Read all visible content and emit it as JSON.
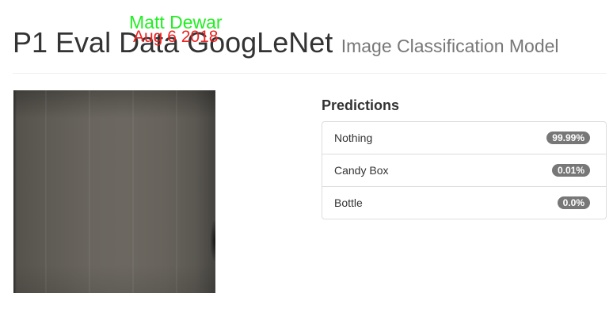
{
  "header": {
    "title": "P1 Eval Data GoogLeNet",
    "subtitle": "Image Classification Model"
  },
  "overlay": {
    "name": "Matt Dewar",
    "date": "Aug 6 2018",
    "name_color": "#22ee22",
    "date_color": "#ee2222"
  },
  "predictions": {
    "heading": "Predictions",
    "items": [
      {
        "label": "Nothing",
        "value": "99.99%"
      },
      {
        "label": "Candy Box",
        "value": "0.01%"
      },
      {
        "label": "Bottle",
        "value": "0.0%"
      }
    ]
  },
  "colors": {
    "badge": "#777777",
    "subtitle": "#777777"
  }
}
